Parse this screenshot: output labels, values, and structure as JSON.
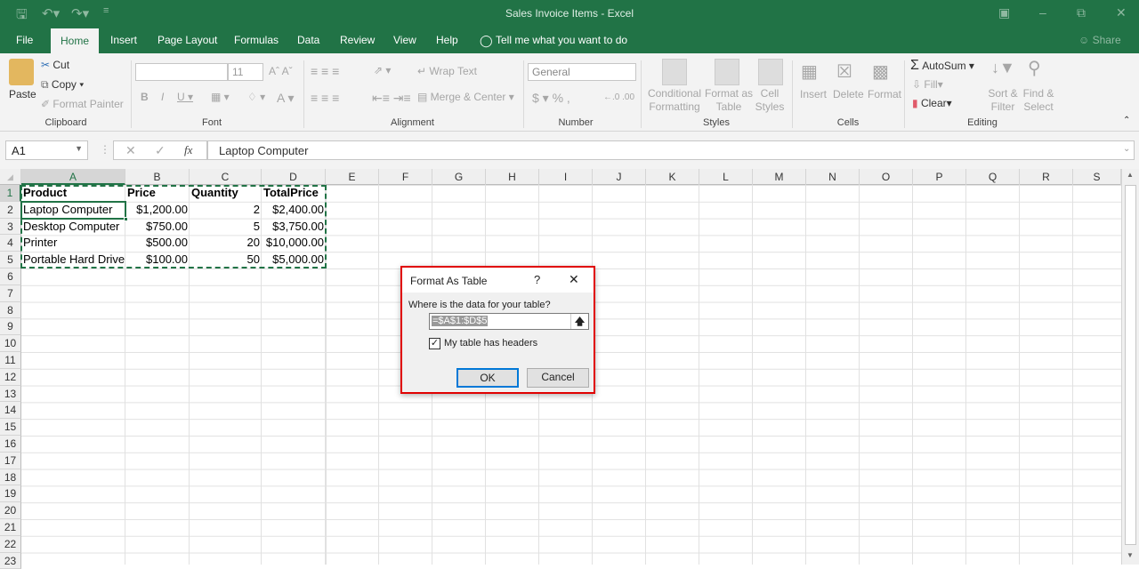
{
  "window": {
    "title": "Sales Invoice Items  -  Excel"
  },
  "qat": {
    "save_icon": "save-icon",
    "undo_icon": "undo-icon",
    "redo_icon": "redo-icon",
    "customize_icon": "customize-qat-icon"
  },
  "tabs": [
    "File",
    "Home",
    "Insert",
    "Page Layout",
    "Formulas",
    "Data",
    "Review",
    "View",
    "Help"
  ],
  "tell_me": "Tell me what you want to do",
  "share": "Share",
  "ribbon": {
    "clipboard": {
      "label": "Clipboard",
      "paste": "Paste",
      "cut": "Cut",
      "copy": "Copy",
      "format_painter": "Format Painter"
    },
    "font": {
      "label": "Font",
      "font_name": "",
      "font_size": "11"
    },
    "alignment": {
      "label": "Alignment",
      "wrap_text": "Wrap Text",
      "merge_center": "Merge & Center"
    },
    "number": {
      "label": "Number",
      "format": "General"
    },
    "styles": {
      "label": "Styles",
      "conditional": [
        "Conditional",
        "Formatting"
      ],
      "format_table": [
        "Format as",
        "Table"
      ],
      "cell_styles": [
        "Cell",
        "Styles"
      ]
    },
    "cells": {
      "label": "Cells",
      "insert": "Insert",
      "delete": "Delete",
      "format": "Format"
    },
    "editing": {
      "label": "Editing",
      "autosum": "AutoSum",
      "fill": "Fill",
      "clear": "Clear",
      "sort": [
        "Sort &",
        "Filter"
      ],
      "find": [
        "Find &",
        "Select"
      ]
    }
  },
  "formula_bar": {
    "name_box": "A1",
    "formula": "Laptop Computer"
  },
  "columns": [
    "A",
    "B",
    "C",
    "D",
    "E",
    "F",
    "G",
    "H",
    "I",
    "J",
    "K",
    "L",
    "M",
    "N",
    "O",
    "P",
    "Q",
    "R",
    "S"
  ],
  "rows": [
    "1",
    "2",
    "3",
    "4",
    "5",
    "6",
    "7",
    "8",
    "9",
    "10",
    "11",
    "12",
    "13",
    "14",
    "15",
    "16",
    "17",
    "18",
    "19",
    "20",
    "21",
    "22",
    "23"
  ],
  "sheet": {
    "headers": [
      "Product",
      "Price",
      "Quantity",
      "TotalPrice"
    ],
    "data": [
      [
        "Laptop Computer",
        "$1,200.00",
        "2",
        "$2,400.00"
      ],
      [
        "Desktop Computer",
        "$750.00",
        "5",
        "$3,750.00"
      ],
      [
        "Printer",
        "$500.00",
        "20",
        "$10,000.00"
      ],
      [
        "Portable Hard Drive",
        "$100.00",
        "50",
        "$5,000.00"
      ]
    ]
  },
  "dialog": {
    "title": "Format As Table",
    "help": "?",
    "prompt": "Where is the data for your table?",
    "range": "=$A$1:$D$5",
    "has_headers_label": "My table has headers",
    "has_headers": true,
    "ok": "OK",
    "cancel": "Cancel"
  },
  "colors": {
    "brand": "#217346",
    "dialog_highlight": "#e00000"
  }
}
